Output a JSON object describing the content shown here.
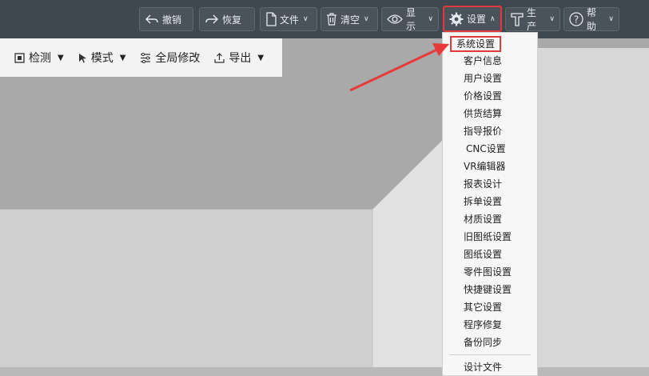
{
  "toolbar": {
    "undo": "撤销",
    "redo": "恢复",
    "file": "文件",
    "clear": "清空",
    "display": "显示",
    "settings": "设置",
    "production": "生产",
    "help": "帮助"
  },
  "subbar": {
    "detect": "检测",
    "mode": "模式",
    "global_edit": "全局修改",
    "export": "导出"
  },
  "menu": {
    "items": [
      "系统设置",
      "客户信息",
      "用户设置",
      "价格设置",
      "供货结算",
      "指导报价",
      "CNC设置",
      "VR编辑器",
      "报表设计",
      "拆单设置",
      "材质设置",
      "旧图纸设置",
      "图纸设置",
      "零件图设置",
      "快捷键设置",
      "其它设置",
      "程序修复",
      "备份同步",
      "设计文件"
    ]
  },
  "colors": {
    "highlight": "#e03b3b",
    "toolbar": "#3f4750"
  }
}
